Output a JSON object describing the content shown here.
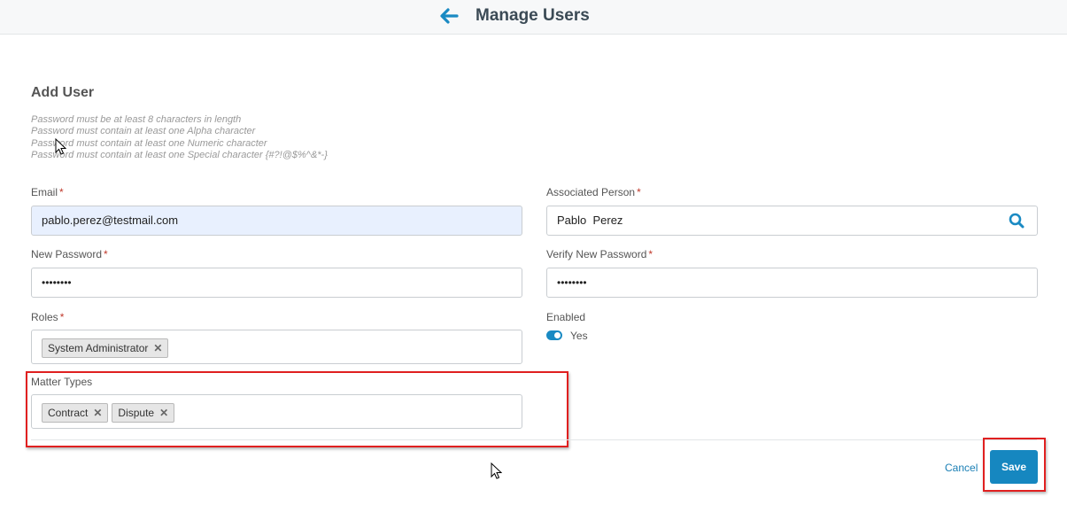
{
  "header": {
    "title": "Manage Users",
    "back_icon": "arrow-left-icon"
  },
  "form": {
    "title": "Add User",
    "password_rules": [
      "Password must be at least 8 characters in length",
      "Password must contain at least one Alpha character",
      "Password must contain at least one Numeric character",
      "Password must contain at least one Special character {#?!@$%^&*-}"
    ],
    "required_marker": "*",
    "email": {
      "label": "Email",
      "value": "pablo.perez@testmail.com"
    },
    "associated_person": {
      "label": "Associated Person",
      "value": "Pablo  Perez",
      "icon": "search-icon"
    },
    "new_password": {
      "label": "New Password",
      "value": "••••••••"
    },
    "verify_password": {
      "label": "Verify New Password",
      "value": "••••••••"
    },
    "roles": {
      "label": "Roles",
      "tags": [
        "System Administrator"
      ]
    },
    "enabled": {
      "label": "Enabled",
      "value": "Yes"
    },
    "matter_types": {
      "label": "Matter Types",
      "tags": [
        "Contract",
        "Dispute"
      ]
    },
    "tag_remove": "✕"
  },
  "actions": {
    "cancel": "Cancel",
    "save": "Save"
  },
  "colors": {
    "accent": "#1687c0",
    "highlight": "#e02020",
    "required": "#c0392b"
  }
}
